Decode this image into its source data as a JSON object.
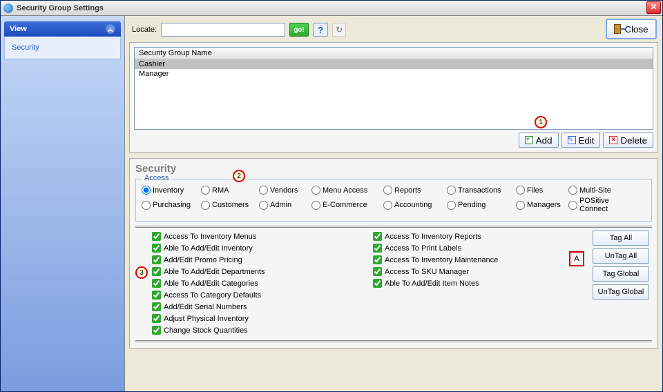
{
  "window": {
    "title": "Security Group Settings",
    "close_label": "Close"
  },
  "sidebar": {
    "panel_title": "View",
    "items": [
      {
        "label": "Security"
      }
    ]
  },
  "locate": {
    "label": "Locate:",
    "go": "go!",
    "help": "?",
    "refresh": "↻"
  },
  "groups": {
    "header": "Security Group Name",
    "rows": [
      {
        "name": "Cashier",
        "selected": true
      },
      {
        "name": "Manager"
      }
    ],
    "add": "Add",
    "edit": "Edit",
    "delete": "Delete"
  },
  "security": {
    "title": "Security",
    "access_legend": "Access",
    "radios_row1": [
      {
        "label": "Inventory",
        "selected": true
      },
      {
        "label": "RMA"
      },
      {
        "label": "Vendors"
      },
      {
        "label": "Menu Access"
      },
      {
        "label": "Reports"
      },
      {
        "label": "Transactions"
      },
      {
        "label": "Files"
      },
      {
        "label": "Multi-Site"
      }
    ],
    "radios_row2": [
      {
        "label": "Purchasing"
      },
      {
        "label": "Customers"
      },
      {
        "label": "Admin"
      },
      {
        "label": "E-Commerce"
      },
      {
        "label": "Accounting"
      },
      {
        "label": "Pending"
      },
      {
        "label": "Managers"
      },
      {
        "label": "POSitive Connect"
      }
    ],
    "perms_col1": [
      "Access To Inventory Menus",
      "Able To Add/Edit Inventory",
      "Add/Edit Promo Pricing",
      "Able To Add/Edit Departments",
      "Able To Add/Edit Categories",
      "Access To Category Defaults",
      "Add/Edit Serial Numbers",
      "Adjust Physical Inventory",
      "Change Stock Quantities"
    ],
    "perms_col2": [
      "Access To Inventory Reports",
      "Access To Print Labels",
      "Access To Inventory Maintenance",
      "Access To SKU Manager",
      "Able To Add/Edit Item Notes"
    ],
    "tag_all": "Tag All",
    "untag_all": "UnTag All",
    "tag_global": "Tag Global",
    "untag_global": "UnTag Global"
  },
  "callouts": {
    "c1": "1",
    "c2": "2",
    "c3": "3",
    "cA": "A"
  }
}
